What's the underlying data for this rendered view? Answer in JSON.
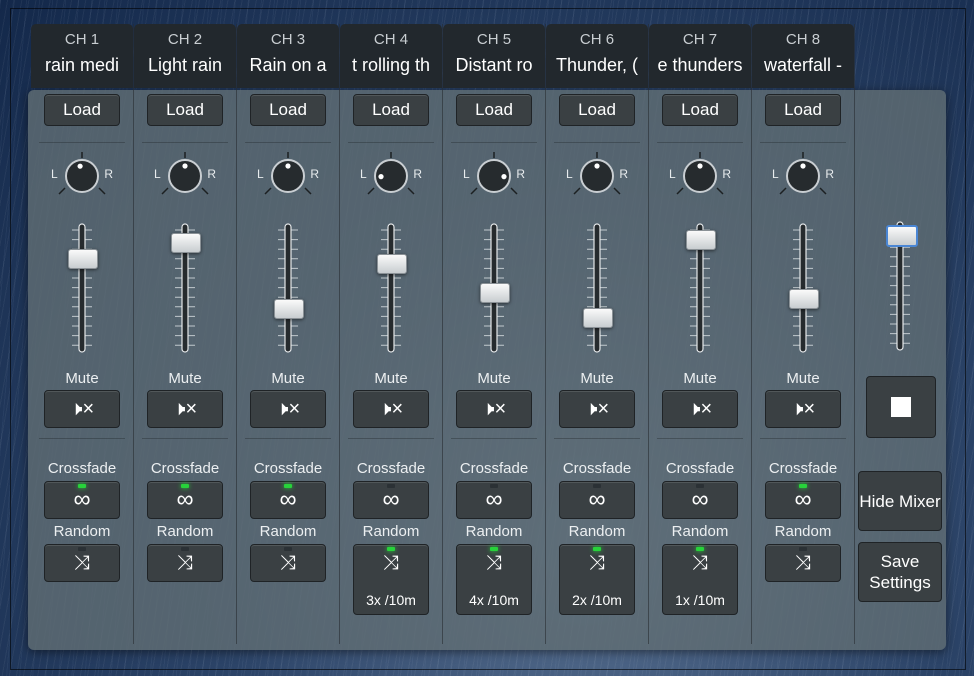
{
  "channels": [
    {
      "num": "CH 1",
      "name": "rain medi",
      "load": "Load",
      "pan": -0.1,
      "volume": 0.78,
      "mute_label": "Mute",
      "crossfade_label": "Crossfade",
      "crossfade_on": true,
      "random_label": "Random",
      "random_on": false,
      "random_status": ""
    },
    {
      "num": "CH 2",
      "name": "Light rain",
      "load": "Load",
      "pan": 0.0,
      "volume": 0.92,
      "mute_label": "Mute",
      "crossfade_label": "Crossfade",
      "crossfade_on": true,
      "random_label": "Random",
      "random_on": false,
      "random_status": ""
    },
    {
      "num": "CH 3",
      "name": "Rain on a",
      "load": "Load",
      "pan": 0.0,
      "volume": 0.33,
      "mute_label": "Mute",
      "crossfade_label": "Crossfade",
      "crossfade_on": true,
      "random_label": "Random",
      "random_on": false,
      "random_status": ""
    },
    {
      "num": "CH 4",
      "name": "t rolling th",
      "load": "Load",
      "pan": -0.85,
      "volume": 0.73,
      "mute_label": "Mute",
      "crossfade_label": "Crossfade",
      "crossfade_on": false,
      "random_label": "Random",
      "random_on": true,
      "random_status": "3x /10m"
    },
    {
      "num": "CH 5",
      "name": "Distant ro",
      "load": "Load",
      "pan": 0.85,
      "volume": 0.47,
      "mute_label": "Mute",
      "crossfade_label": "Crossfade",
      "crossfade_on": false,
      "random_label": "Random",
      "random_on": true,
      "random_status": "4x /10m"
    },
    {
      "num": "CH 6",
      "name": "Thunder, (",
      "load": "Load",
      "pan": 0.0,
      "volume": 0.25,
      "mute_label": "Mute",
      "crossfade_label": "Crossfade",
      "crossfade_on": false,
      "random_label": "Random",
      "random_on": true,
      "random_status": "2x /10m"
    },
    {
      "num": "CH 7",
      "name": "e thunders",
      "load": "Load",
      "pan": 0.0,
      "volume": 0.95,
      "mute_label": "Mute",
      "crossfade_label": "Crossfade",
      "crossfade_on": false,
      "random_label": "Random",
      "random_on": true,
      "random_status": "1x /10m"
    },
    {
      "num": "CH 8",
      "name": "waterfall -",
      "load": "Load",
      "pan": 0.0,
      "volume": 0.42,
      "mute_label": "Mute",
      "crossfade_label": "Crossfade",
      "crossfade_on": true,
      "random_label": "Random",
      "random_on": false,
      "random_status": ""
    }
  ],
  "pan_labels": {
    "left": "L",
    "right": "R"
  },
  "icons": {
    "mute": "speaker-mute-icon",
    "crossfade": "infinity-icon",
    "random": "shuffle-icon",
    "stop": "stop-icon"
  },
  "master": {
    "volume": 0.97,
    "hide_mixer": "Hide Mixer",
    "save_settings": "Save Settings"
  },
  "colors": {
    "led_on": "#27d33a",
    "master_accent": "#4a86d4"
  }
}
